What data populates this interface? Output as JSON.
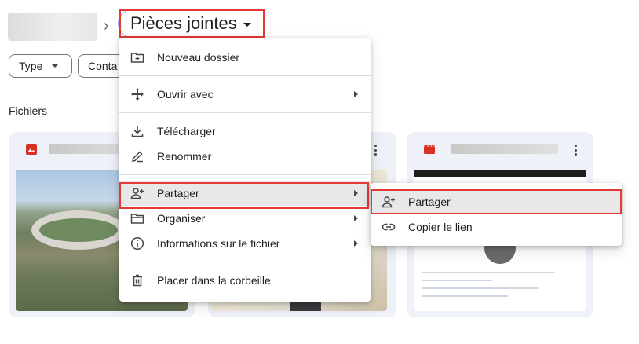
{
  "breadcrumb": {
    "separator": "›",
    "current": "Pièces jointes"
  },
  "filters": {
    "type_label": "Type",
    "contact_label": "Conta"
  },
  "section": {
    "files_label": "Fichiers"
  },
  "context_menu": {
    "items": [
      {
        "label": "Nouveau dossier",
        "icon": "new-folder-icon"
      },
      {
        "label": "Ouvrir avec",
        "icon": "open-with-icon",
        "has_submenu": true
      },
      {
        "label": "Télécharger",
        "icon": "download-icon"
      },
      {
        "label": "Renommer",
        "icon": "rename-icon"
      },
      {
        "label": "Partager",
        "icon": "share-person-add-icon",
        "has_submenu": true,
        "active": true
      },
      {
        "label": "Organiser",
        "icon": "folder-open-icon",
        "has_submenu": true
      },
      {
        "label": "Informations sur le fichier",
        "icon": "info-icon",
        "has_submenu": true
      },
      {
        "label": "Placer dans la corbeille",
        "icon": "trash-icon"
      }
    ]
  },
  "share_submenu": {
    "items": [
      {
        "label": "Partager",
        "icon": "share-person-add-icon",
        "active": true
      },
      {
        "label": "Copier le lien",
        "icon": "link-icon"
      }
    ]
  },
  "colors": {
    "highlight_border": "#e53935",
    "image_icon": "#d93025",
    "video_icon": "#d93025",
    "card_bg": "#eef1f8"
  }
}
